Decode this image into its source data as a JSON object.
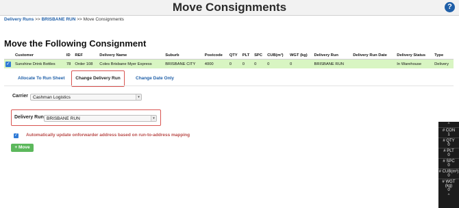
{
  "header": {
    "title": "Move Consignments",
    "help": "?"
  },
  "breadcrumb": {
    "items": [
      "Delivery Runs",
      "BRISBANE RUN",
      "Move Consignments"
    ],
    "separator": ">>"
  },
  "section_title": "Move the Following Consignment",
  "table": {
    "headers": [
      "",
      "Customer",
      "ID",
      "REF",
      "Delivery Name",
      "Suburb",
      "Postcode",
      "QTY",
      "PLT",
      "SPC",
      "CUB(m³)",
      "WGT (kg)",
      "Delivery Run",
      "Delivery Run Date",
      "Delivery Status",
      "Type"
    ],
    "rows": [
      [
        "✓",
        "Sunshine Drink Bottles",
        "78",
        "Order 108",
        "Coles Brisbane Myer Express",
        "BRISBANE CITY",
        "4000",
        "0",
        "0",
        "0",
        "0",
        "0",
        "BRISBANE RUN",
        "",
        "In Warehouse",
        "Delivery"
      ]
    ]
  },
  "tabs": {
    "allocate": "Allocate To Run Sheet",
    "change_run": "Change Delivery Run",
    "change_date": "Change Date Only"
  },
  "form": {
    "carrier_label": "Carrier",
    "carrier_value": "Cashman Logistics",
    "run_label": "Delivery Run",
    "run_value": "BRISBANE RUN",
    "auto_update_label": "Automatically update onforwarder address based on run-to-address mapping",
    "move_button": "+ Move"
  },
  "side_panel": {
    "caret": "^",
    "metrics": [
      {
        "label": "# CON",
        "value": "1"
      },
      {
        "label": "# QTY",
        "value": "0"
      },
      {
        "label": "# PLT",
        "value": "0"
      },
      {
        "label": "# SPC",
        "value": "0"
      },
      {
        "label": "# CUB(m³)",
        "value": "0"
      },
      {
        "label": "# WGT (kg)",
        "value": "0"
      }
    ],
    "footer_caret": "^"
  },
  "colors": {
    "accent": "#1f5fa8",
    "row_highlight": "#d8f5c2",
    "active_tab_border": "#d9534f",
    "move_button": "#5cb85c",
    "warning_text": "#b94a48"
  }
}
